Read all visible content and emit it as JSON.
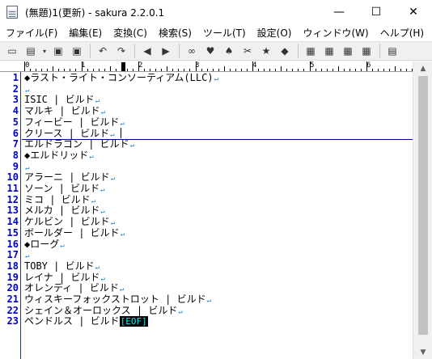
{
  "window": {
    "title": "(無題)1(更新) - sakura 2.2.0.1",
    "controls": {
      "minimize": "—",
      "maximize": "☐",
      "close": "✕"
    }
  },
  "menu": {
    "items": [
      "ファイル(F)",
      "編集(E)",
      "変換(C)",
      "検索(S)",
      "ツール(T)",
      "設定(O)",
      "ウィンドウ(W)",
      "ヘルプ(H)"
    ]
  },
  "toolbar": {
    "icons": [
      "new-file-icon",
      "open-folder-icon",
      "dropdown-arrow-icon",
      "save-icon",
      "save-all-icon",
      "undo-icon",
      "redo-icon",
      "jump-back-icon",
      "jump-forward-icon",
      "search-icon",
      "search-prev-icon",
      "search-next-icon",
      "replace-icon",
      "bookmark-icon",
      "grep-icon",
      "compare-icon",
      "settings-icon",
      "font-icon",
      "type-settings-icon",
      "outline-icon"
    ],
    "glyphs": [
      "▭",
      "▤",
      "▾",
      "▣",
      "▣",
      "↶",
      "↷",
      "◀",
      "▶",
      "∞",
      "♥",
      "♠",
      "✂",
      "★",
      "◆",
      "▦",
      "▦",
      "▦",
      "▦",
      "▤"
    ]
  },
  "ruler": {
    "labels": [
      "0",
      "1",
      "2",
      "3",
      "4",
      "5",
      "6"
    ]
  },
  "editor": {
    "eol_mark": "↵",
    "eof_mark": "[EOF]",
    "lines": [
      {
        "n": "1",
        "text": "◆ラスト・ライト・コンソーティアム(LLC)"
      },
      {
        "n": "2",
        "text": ""
      },
      {
        "n": "3",
        "text": "ISIC | ビルド"
      },
      {
        "n": "4",
        "text": "マルキ | ビルド"
      },
      {
        "n": "5",
        "text": "フィービー | ビルド"
      },
      {
        "n": "6",
        "text": "クリース | ビルド"
      },
      {
        "n": "7",
        "text": "エルドラゴン | ビルド"
      },
      {
        "n": "8",
        "text": "◆エルドリッド"
      },
      {
        "n": "9",
        "text": ""
      },
      {
        "n": "10",
        "text": "アラーニ | ビルド"
      },
      {
        "n": "11",
        "text": "ソーン | ビルド"
      },
      {
        "n": "12",
        "text": "ミコ | ビルド"
      },
      {
        "n": "13",
        "text": "メルカ | ビルド"
      },
      {
        "n": "14",
        "text": "ケルビン | ビルド"
      },
      {
        "n": "15",
        "text": "ボールダー | ビルド"
      },
      {
        "n": "16",
        "text": "◆ローグ"
      },
      {
        "n": "17",
        "text": ""
      },
      {
        "n": "18",
        "text": "TOBY | ビルド"
      },
      {
        "n": "19",
        "text": "レイナ | ビルド"
      },
      {
        "n": "20",
        "text": "オレンディ | ビルド"
      },
      {
        "n": "21",
        "text": "ウィスキーフォックストロット | ビルド"
      },
      {
        "n": "22",
        "text": "シェイン＆オーロックス | ビルド"
      },
      {
        "n": "23",
        "text": "ペンドルス | ビルド"
      }
    ]
  },
  "scrollbar": {
    "up": "▲",
    "down": "▼"
  }
}
